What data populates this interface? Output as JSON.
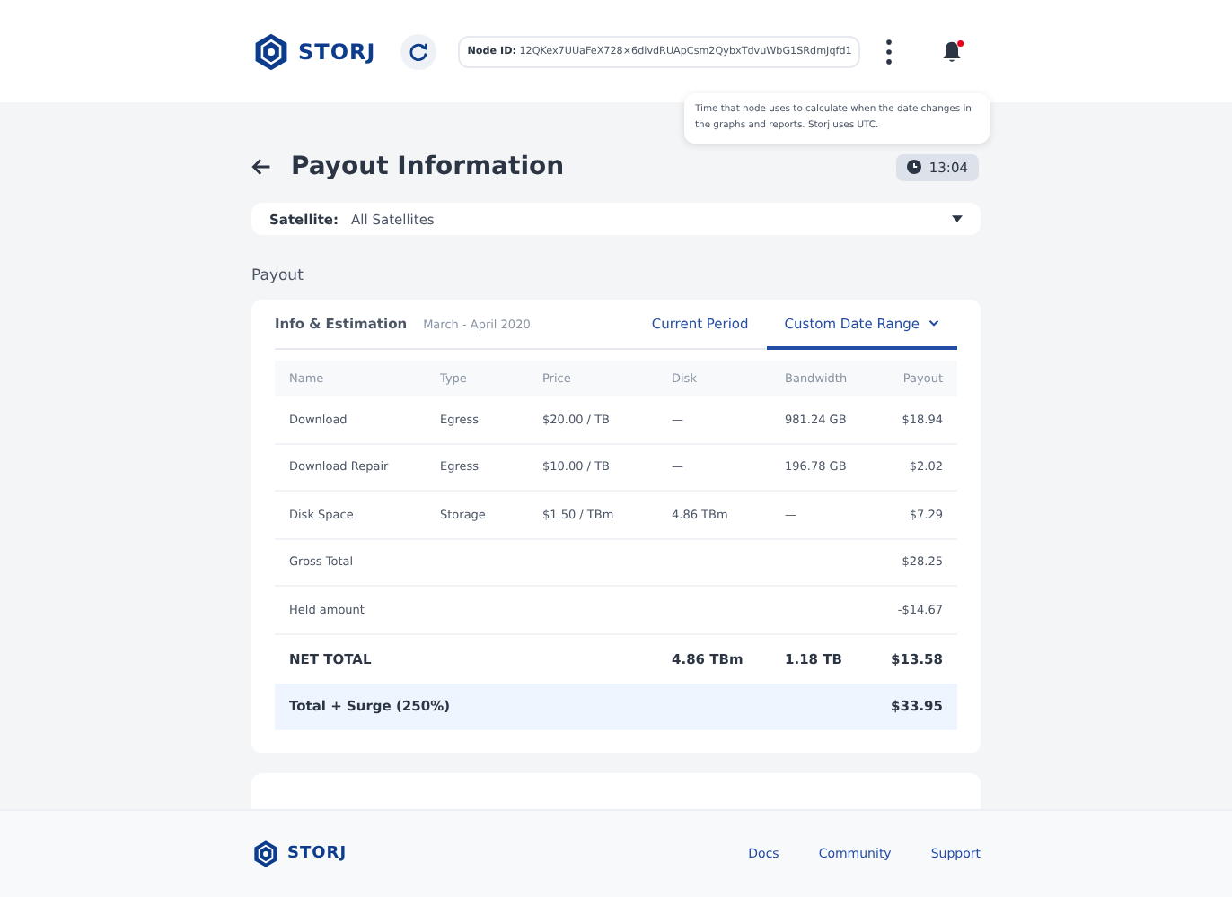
{
  "header": {
    "logo_text": "STORJ",
    "node_id_label": "Node ID:",
    "node_id": "12QKex7UUaFeX728×6dlvdRUApCsm2QybxTdvuWbG1SRdmJqfd1",
    "notifications_unread": true
  },
  "tooltip": {
    "text": "Time that node uses to calculate when the date changes in the graphs and reports. Storj uses UTC."
  },
  "page": {
    "title": "Payout Information",
    "time": "13:04"
  },
  "satellite": {
    "label": "Satellite:",
    "value": "All Satellites"
  },
  "section_title": "Payout",
  "payout_card": {
    "title": "Info & Estimation",
    "period": "March - April 2020",
    "tabs": [
      {
        "label": "Current Period",
        "selected": false,
        "has_caret": false
      },
      {
        "label": "Custom Date Range",
        "selected": true,
        "has_caret": true
      }
    ]
  },
  "table": {
    "columns": [
      "Name",
      "Type",
      "Price",
      "Disk",
      "Bandwidth",
      "Payout"
    ],
    "rows": [
      {
        "kind": "item",
        "cells": [
          "Download",
          "Egress",
          "$20.00 / TB",
          "—",
          "981.24 GB",
          "$18.94"
        ]
      },
      {
        "kind": "item",
        "cells": [
          "Download Repair",
          "Egress",
          "$10.00 / TB",
          "—",
          "196.78 GB",
          "$2.02"
        ]
      },
      {
        "kind": "item",
        "cells": [
          "Disk Space",
          "Storage",
          "$1.50 / TBm",
          "4.86 TBm",
          "—",
          "$7.29"
        ]
      },
      {
        "kind": "subtotal",
        "cells": [
          "Gross Total",
          "",
          "",
          "",
          "",
          "$28.25"
        ]
      },
      {
        "kind": "subtotal",
        "cells": [
          "Held amount",
          "",
          "",
          "",
          "",
          "-$14.67"
        ]
      },
      {
        "kind": "net",
        "cells": [
          "NET TOTAL",
          "",
          "",
          "4.86 TBm",
          "1.18 TB",
          "$13.58"
        ]
      },
      {
        "kind": "surge",
        "cells": [
          "Total + Surge (250%)",
          "",
          "",
          "",
          "",
          "$33.95"
        ]
      }
    ]
  },
  "footer": {
    "logo_text": "STORJ",
    "links": [
      "Docs",
      "Community",
      "Support"
    ]
  }
}
